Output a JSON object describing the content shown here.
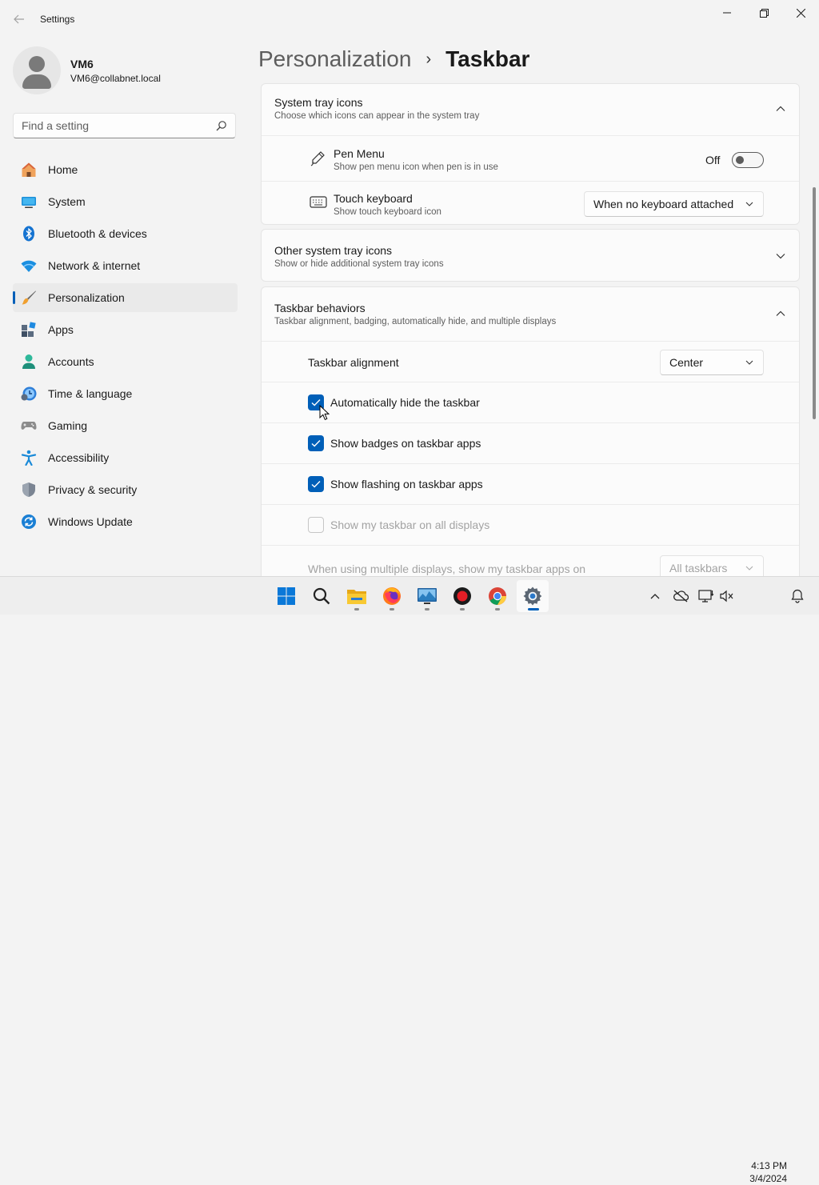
{
  "app": {
    "title": "Settings"
  },
  "user": {
    "name": "VM6",
    "email": "VM6@collabnet.local"
  },
  "search": {
    "placeholder": "Find a setting"
  },
  "nav": [
    {
      "label": "Home",
      "icon": "home-icon"
    },
    {
      "label": "System",
      "icon": "system-icon"
    },
    {
      "label": "Bluetooth & devices",
      "icon": "bluetooth-icon"
    },
    {
      "label": "Network & internet",
      "icon": "wifi-icon"
    },
    {
      "label": "Personalization",
      "icon": "brush-icon",
      "active": true
    },
    {
      "label": "Apps",
      "icon": "apps-icon"
    },
    {
      "label": "Accounts",
      "icon": "accounts-icon"
    },
    {
      "label": "Time & language",
      "icon": "clock-globe-icon"
    },
    {
      "label": "Gaming",
      "icon": "gamepad-icon"
    },
    {
      "label": "Accessibility",
      "icon": "accessibility-icon"
    },
    {
      "label": "Privacy & security",
      "icon": "shield-icon"
    },
    {
      "label": "Windows Update",
      "icon": "update-icon"
    }
  ],
  "breadcrumb": {
    "parent": "Personalization",
    "separator": "›",
    "current": "Taskbar"
  },
  "system_tray": {
    "title": "System tray icons",
    "subtitle": "Choose which icons can appear in the system tray",
    "pen_menu": {
      "title": "Pen Menu",
      "subtitle": "Show pen menu icon when pen is in use",
      "state_label": "Off",
      "on": false
    },
    "touch_keyboard": {
      "title": "Touch keyboard",
      "subtitle": "Show touch keyboard icon",
      "value": "When no keyboard attached"
    }
  },
  "other_tray": {
    "title": "Other system tray icons",
    "subtitle": "Show or hide additional system tray icons"
  },
  "behaviors": {
    "title": "Taskbar behaviors",
    "subtitle": "Taskbar alignment, badging, automatically hide, and multiple displays",
    "alignment": {
      "label": "Taskbar alignment",
      "value": "Center"
    },
    "auto_hide": {
      "label": "Automatically hide the taskbar",
      "checked": true
    },
    "badges": {
      "label": "Show badges on taskbar apps",
      "checked": true
    },
    "flashing": {
      "label": "Show flashing on taskbar apps",
      "checked": true
    },
    "all_displays": {
      "label": "Show my taskbar on all displays",
      "checked": false
    },
    "multi_display": {
      "label": "When using multiple displays, show my taskbar apps on",
      "value": "All taskbars"
    }
  },
  "taskbar": {
    "apps": [
      "start-icon",
      "search-icon",
      "file-explorer-icon",
      "firefox-icon",
      "monitor-app-icon",
      "recorder-icon",
      "chrome-icon",
      "settings-icon"
    ],
    "time": "4:13 PM",
    "date": "3/4/2024"
  },
  "colors": {
    "accent": "#005fb8",
    "background": "#f3f3f3",
    "card": "#fbfbfb"
  }
}
